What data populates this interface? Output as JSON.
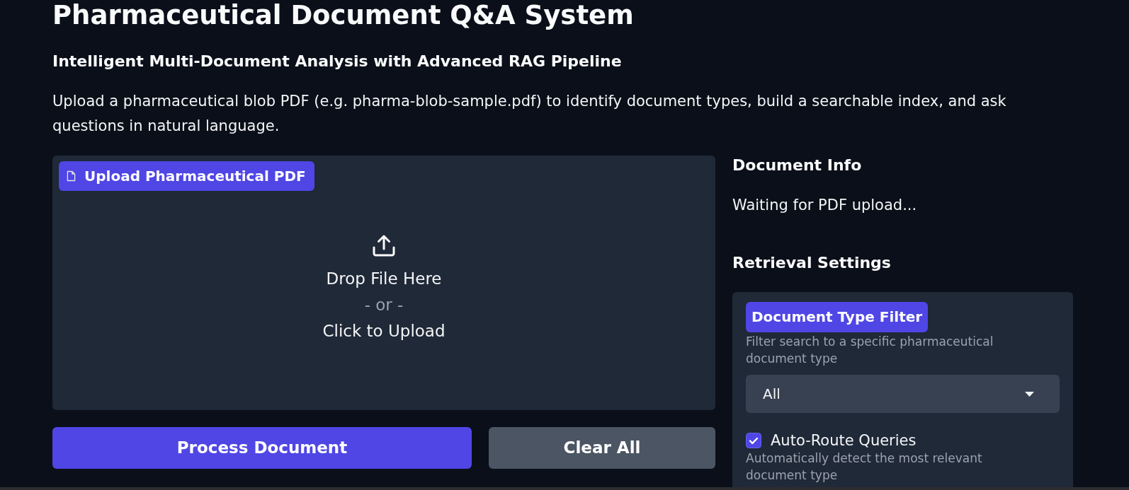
{
  "header": {
    "title": "Pharmaceutical Document Q&A System",
    "subtitle": "Intelligent Multi-Document Analysis with Advanced RAG Pipeline",
    "description": "Upload a pharmaceutical blob PDF (e.g. pharma-blob-sample.pdf) to identify document types, build a searchable index, and ask questions in natural language."
  },
  "upload": {
    "label": "Upload Pharmaceutical PDF",
    "drop_text": "Drop File Here",
    "or_text": "- or -",
    "click_text": "Click to Upload"
  },
  "buttons": [
    {
      "label": "Process Document",
      "kind": "primary"
    },
    {
      "label": "Clear All",
      "kind": "secondary"
    }
  ],
  "document_info": {
    "heading": "Document Info",
    "status": "Waiting for PDF upload..."
  },
  "retrieval_settings": {
    "heading": "Retrieval Settings",
    "controls": [
      {
        "kind": "dropdown",
        "label": "Document Type Filter",
        "info": "Filter search to a specific pharmaceutical document type",
        "value": "All"
      },
      {
        "kind": "checkbox",
        "label": "Auto-Route Queries",
        "checked": true,
        "info": "Automatically detect the most relevant document type"
      }
    ]
  }
}
